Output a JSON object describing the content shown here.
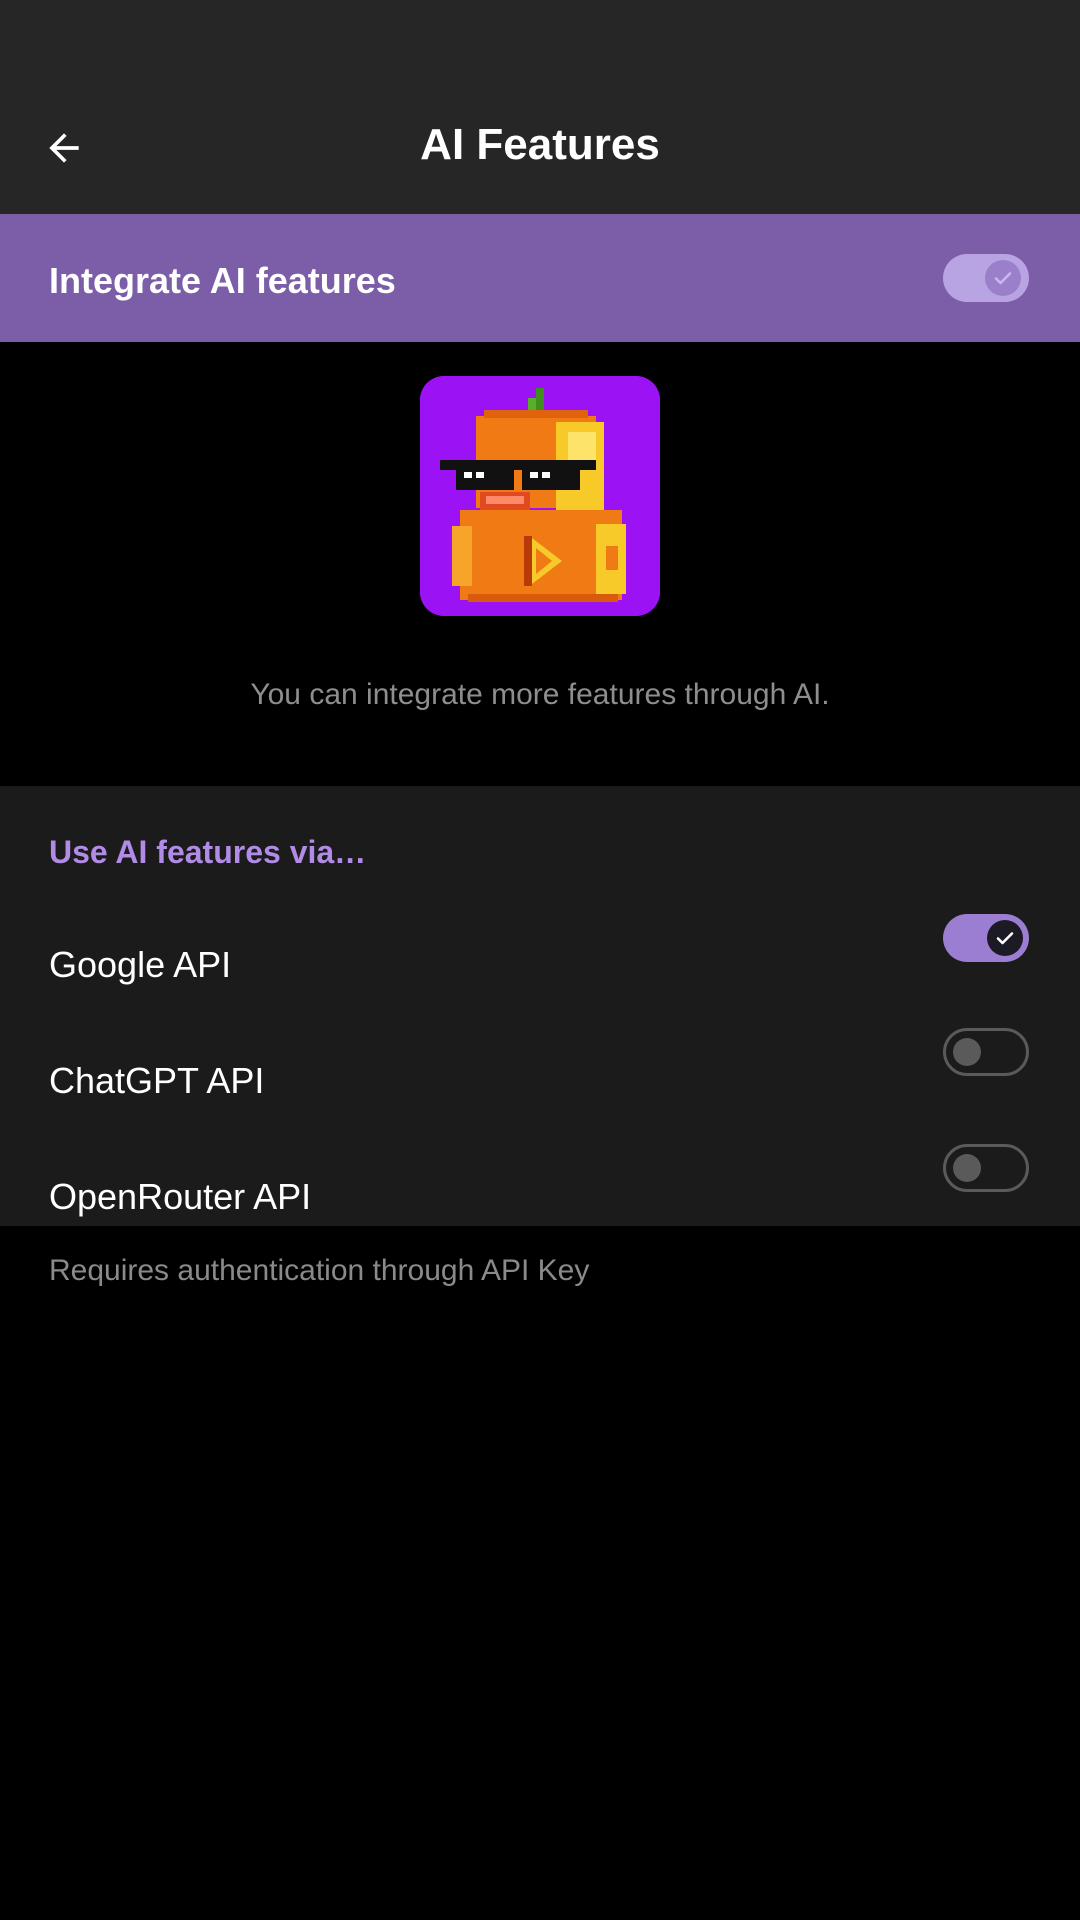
{
  "header": {
    "title": "AI Features",
    "back_icon": "arrow-left-icon"
  },
  "master": {
    "label": "Integrate AI features",
    "enabled": true,
    "banner_color": "#7b5ea7"
  },
  "hero": {
    "image": "pixel-duck-sunglasses",
    "caption": "You can integrate more features through AI."
  },
  "providers": {
    "header": "Use AI features via…",
    "items": [
      {
        "label": "Google API",
        "enabled": true
      },
      {
        "label": "ChatGPT API",
        "enabled": false
      },
      {
        "label": "OpenRouter API",
        "enabled": false
      }
    ],
    "footer": "Requires authentication through API Key"
  },
  "colors": {
    "accent": "#9b7dd2",
    "section_header": "#b18be6",
    "image_background": "#9b12f5"
  }
}
